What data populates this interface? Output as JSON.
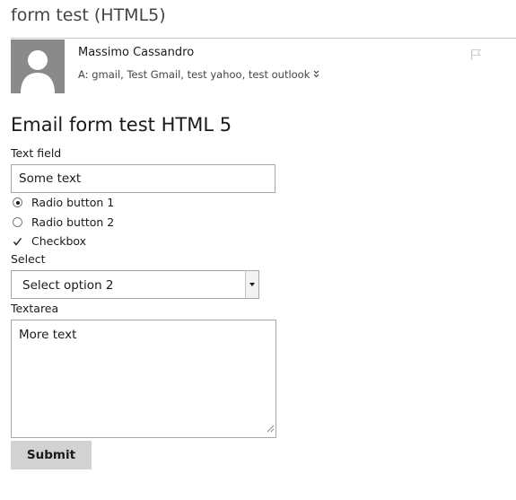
{
  "email": {
    "subject": "form test (HTML5)",
    "sender": "Massimo Cassandro",
    "recipients": "A: gmail, Test Gmail, test yahoo, test outlook"
  },
  "form": {
    "title": "Email form test HTML 5",
    "text_field": {
      "label": "Text field",
      "value": "Some text"
    },
    "radios": [
      {
        "label": "Radio button 1",
        "checked": true
      },
      {
        "label": "Radio button 2",
        "checked": false
      }
    ],
    "checkbox": {
      "label": "Checkbox",
      "checked": true
    },
    "select": {
      "label": "Select",
      "value": "Select option 2"
    },
    "textarea": {
      "label": "Textarea",
      "value": "More text"
    },
    "submit_label": "Submit"
  },
  "icons": {
    "avatar": "person-silhouette-icon",
    "flag": "flag-icon",
    "expand": "double-chevron-down-icon",
    "select_arrow": "caret-down-icon",
    "resize": "resize-grip-icon"
  },
  "colors": {
    "avatar_bg": "#8a8a8a",
    "submit_bg": "#d2d2d2",
    "border": "#a6a6a6"
  }
}
